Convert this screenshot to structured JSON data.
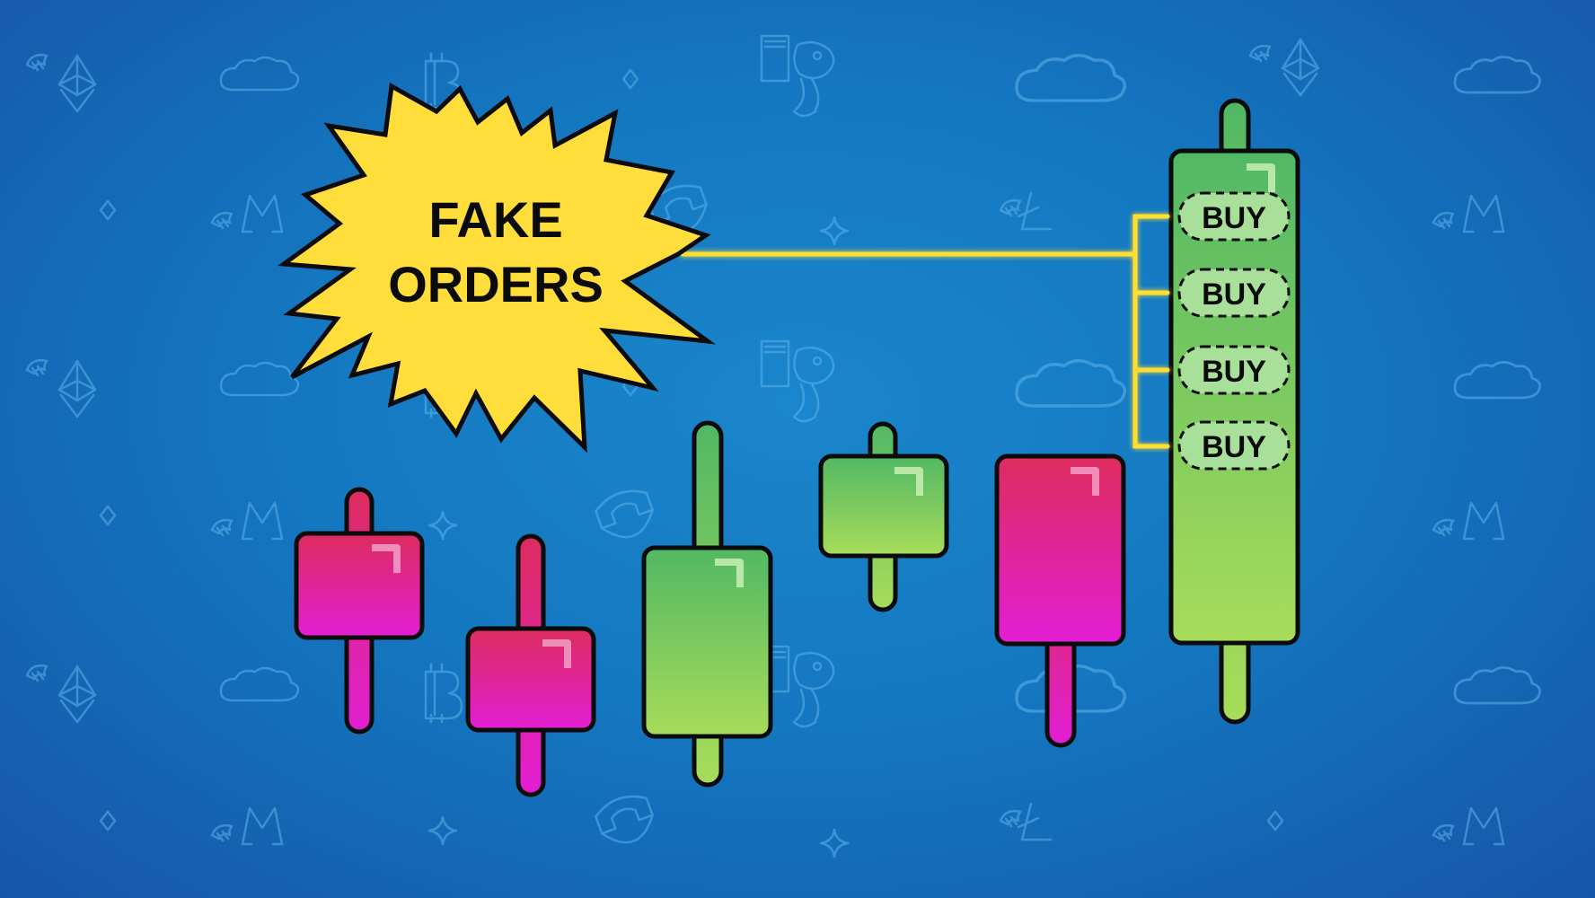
{
  "illustration": {
    "callout_lines": [
      "FAKE",
      "ORDERS"
    ],
    "order_labels": [
      "BUY",
      "BUY",
      "BUY",
      "BUY"
    ],
    "colors": {
      "background_center": "#1a86cc",
      "background_edge": "#1656a8",
      "starburst": "#ffdd3a",
      "connector": "#ffe033",
      "bull_candle_top": "#52b864",
      "bull_candle_bottom": "#a8dc5a",
      "bear_candle_top": "#dd2c5e",
      "bear_candle_bottom": "#e21ed4",
      "outline": "#0b0b0b"
    },
    "candles": [
      {
        "direction": "bearish",
        "icon": "red-candle-icon"
      },
      {
        "direction": "bearish",
        "icon": "red-candle-icon"
      },
      {
        "direction": "bullish",
        "icon": "green-candle-icon"
      },
      {
        "direction": "bullish",
        "icon": "green-candle-icon"
      },
      {
        "direction": "bearish",
        "icon": "red-candle-icon"
      },
      {
        "direction": "bullish",
        "icon": "green-candle-icon"
      }
    ],
    "background_icons": [
      "cloud-icon",
      "bitcoin-icon",
      "ethereum-icon",
      "monero-icon",
      "litecoin-icon",
      "diamond-icon",
      "sparkle-icon",
      "dog-mascot-icon",
      "magnet-icon"
    ]
  }
}
